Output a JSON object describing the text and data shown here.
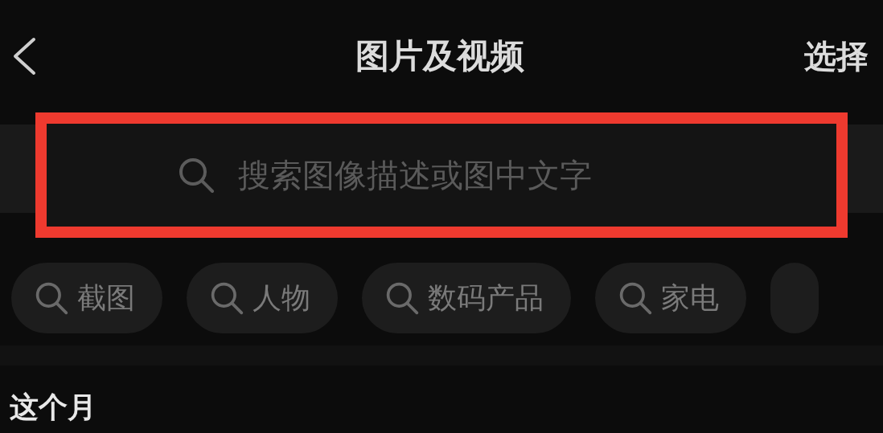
{
  "header": {
    "title": "图片及视频",
    "action": "选择"
  },
  "search": {
    "placeholder": "搜索图像描述或图中文字",
    "highlighted": true
  },
  "chips": [
    {
      "label": "截图"
    },
    {
      "label": "人物"
    },
    {
      "label": "数码产品"
    },
    {
      "label": "家电"
    }
  ],
  "section": {
    "title": "这个月"
  }
}
